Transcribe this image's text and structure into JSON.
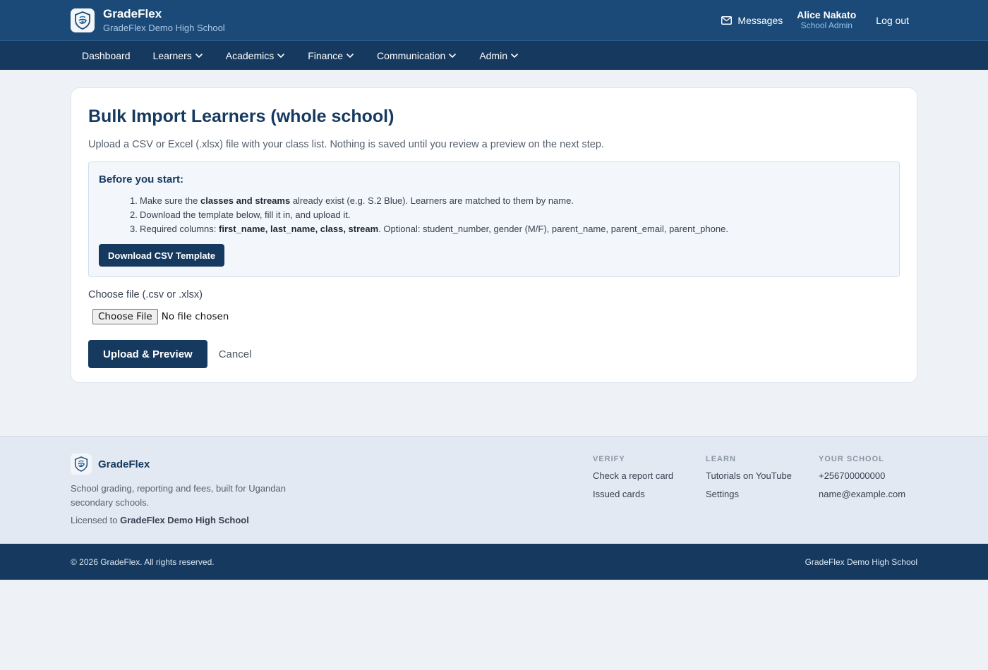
{
  "header": {
    "brand_name": "GradeFlex",
    "school_name": "GradeFlex Demo High School",
    "messages_label": "Messages",
    "user_name": "Alice Nakato",
    "user_role": "School Admin",
    "logout_label": "Log out"
  },
  "nav": {
    "items": [
      {
        "label": "Dashboard"
      },
      {
        "label": "Learners"
      },
      {
        "label": "Academics"
      },
      {
        "label": "Finance"
      },
      {
        "label": "Communication"
      },
      {
        "label": "Admin"
      }
    ]
  },
  "page": {
    "title": "Bulk Import Learners (whole school)",
    "intro": "Upload a CSV or Excel (.xlsx) file with your class list. Nothing is saved until you review a preview on the next step.",
    "info": {
      "title": "Before you start:",
      "step1_pre": "Make sure the ",
      "step1_bold": "classes and streams",
      "step1_post": " already exist (e.g. S.2 Blue). Learners are matched to them by name.",
      "step2": "Download the template below, fill it in, and upload it.",
      "step3_pre": "Required columns: ",
      "step3_bold": "first_name, last_name, class, stream",
      "step3_post": ". Optional: student_number, gender (M/F), parent_name, parent_email, parent_phone.",
      "download_label": "Download CSV Template"
    },
    "file_label": "Choose file (.csv or .xlsx)",
    "file_button": "Choose File",
    "file_status": "No file chosen",
    "submit_label": "Upload & Preview",
    "cancel_label": "Cancel"
  },
  "footer": {
    "brand_name": "GradeFlex",
    "description": "School grading, reporting and fees, built for Ugandan secondary schools.",
    "license_pre": "Licensed to ",
    "license_school": "GradeFlex Demo High School",
    "columns": [
      {
        "title": "VERIFY",
        "links": [
          "Check a report card",
          "Issued cards"
        ]
      },
      {
        "title": "LEARN",
        "links": [
          "Tutorials on YouTube",
          "Settings"
        ]
      },
      {
        "title": "YOUR SCHOOL",
        "links": [
          "+256700000000",
          "name@example.com"
        ]
      }
    ],
    "copyright": "© 2026 GradeFlex. All rights reserved.",
    "bottom_school": "GradeFlex Demo High School"
  },
  "colors": {
    "header_bg": "#1c4a78",
    "nav_bg": "#15395f",
    "accent": "#15395f",
    "page_bg": "#eef2f7"
  }
}
